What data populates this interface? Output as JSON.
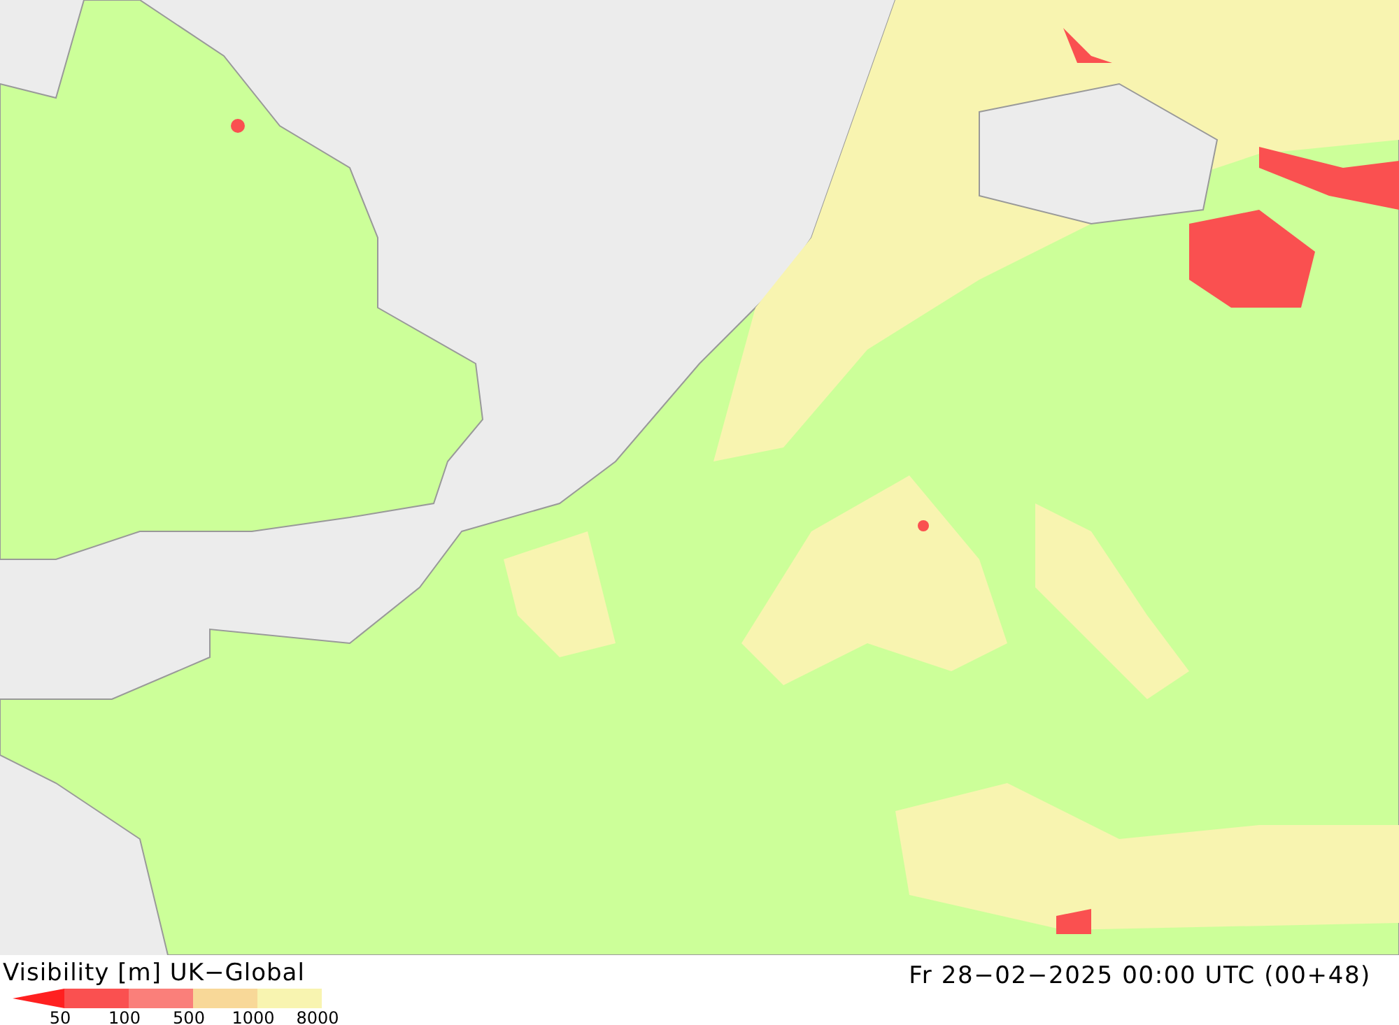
{
  "title": "Visibility [m] UK−Global",
  "valid_time": "Fr 28−02−2025 00:00 UTC (00+48)",
  "legend": [
    {
      "kind": "triangle",
      "color": "#ff2020",
      "label": "50"
    },
    {
      "kind": "bar",
      "color": "#fa5050",
      "label": "100"
    },
    {
      "kind": "bar",
      "color": "#fa7f7a",
      "label": "500"
    },
    {
      "kind": "bar",
      "color": "#f8d898",
      "label": "1000"
    },
    {
      "kind": "bar",
      "color": "#f8f4b0",
      "label": "8000"
    }
  ]
}
